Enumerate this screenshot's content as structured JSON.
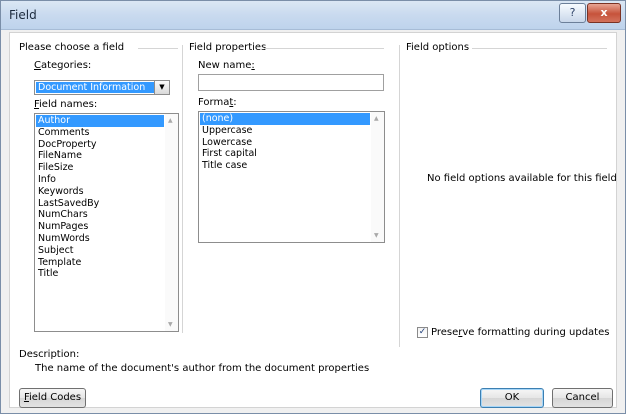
{
  "window": {
    "title": "Field",
    "help_glyph": "?",
    "close_glyph": "x"
  },
  "choose_field": {
    "group_title": "Please choose a field",
    "categories_label_pre": "",
    "categories_label_u": "C",
    "categories_label_post": "ategories:",
    "category_value": "Document Information",
    "field_names_label_u": "F",
    "field_names_label_post": "ield names:",
    "field_names": [
      "Author",
      "Comments",
      "DocProperty",
      "FileName",
      "FileSize",
      "Info",
      "Keywords",
      "LastSavedBy",
      "NumChars",
      "NumPages",
      "NumWords",
      "Subject",
      "Template",
      "Title"
    ],
    "selected_index": 0
  },
  "field_properties": {
    "group_title": "Field properties",
    "new_name_label_pre": "New name",
    "new_name_label_u": ":",
    "new_name_value": "",
    "format_label_pre": "Forma",
    "format_label_u": "t",
    "format_label_post": ":",
    "formats": [
      "(none)",
      "Uppercase",
      "Lowercase",
      "First capital",
      "Title case"
    ],
    "selected_index": 0
  },
  "field_options": {
    "group_title": "Field options",
    "empty_message": "No field options available for this field",
    "preserve_pre": "Prese",
    "preserve_u": "r",
    "preserve_post": "ve formatting during updates",
    "preserve_checked": true,
    "check_glyph": "✓"
  },
  "description": {
    "label": "Description:",
    "text": "The name of the document's author from the document properties"
  },
  "footer": {
    "field_codes_u": "F",
    "field_codes_post": "ield Codes",
    "ok_label": "OK",
    "cancel_label": "Cancel"
  },
  "icons": {
    "dropdown": "chevron-down-icon",
    "scroll_up": "scroll-up-arrow-icon",
    "scroll_down": "scroll-down-arrow-icon"
  }
}
